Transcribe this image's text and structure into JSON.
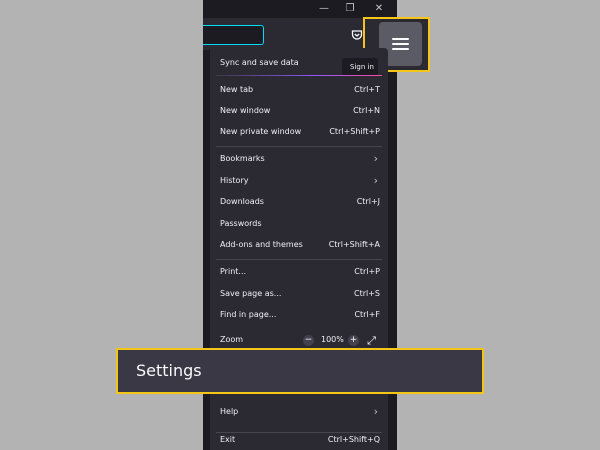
{
  "titlebar": {
    "minimize_glyph": "—",
    "restore_glyph": "❐",
    "close_glyph": "✕"
  },
  "menu": {
    "sync": {
      "label": "Sync and save data",
      "signin_label": "Sign in"
    },
    "items": [
      {
        "label": "New tab",
        "shortcut": "Ctrl+T"
      },
      {
        "label": "New window",
        "shortcut": "Ctrl+N"
      },
      {
        "label": "New private window",
        "shortcut": "Ctrl+Shift+P"
      },
      {
        "label": "Bookmarks",
        "submenu": true
      },
      {
        "label": "History",
        "submenu": true
      },
      {
        "label": "Downloads",
        "shortcut": "Ctrl+J"
      },
      {
        "label": "Passwords"
      },
      {
        "label": "Add-ons and themes",
        "shortcut": "Ctrl+Shift+A"
      },
      {
        "label": "Print...",
        "shortcut": "Ctrl+P"
      },
      {
        "label": "Save page as...",
        "shortcut": "Ctrl+S"
      },
      {
        "label": "Find in page...",
        "shortcut": "Ctrl+F"
      }
    ],
    "zoom": {
      "label": "Zoom",
      "value": "100%",
      "minus": "−",
      "plus": "+",
      "fullscreen": "⤢"
    },
    "settings_label": "Settings",
    "help": {
      "label": "Help",
      "submenu": true
    },
    "exit": {
      "label": "Exit",
      "shortcut": "Ctrl+Shift+Q"
    },
    "chevron_glyph": "›"
  },
  "colors": {
    "highlight_border": "#f5c518",
    "url_focus": "#00ddff",
    "panel_bg": "#2b2a33"
  }
}
